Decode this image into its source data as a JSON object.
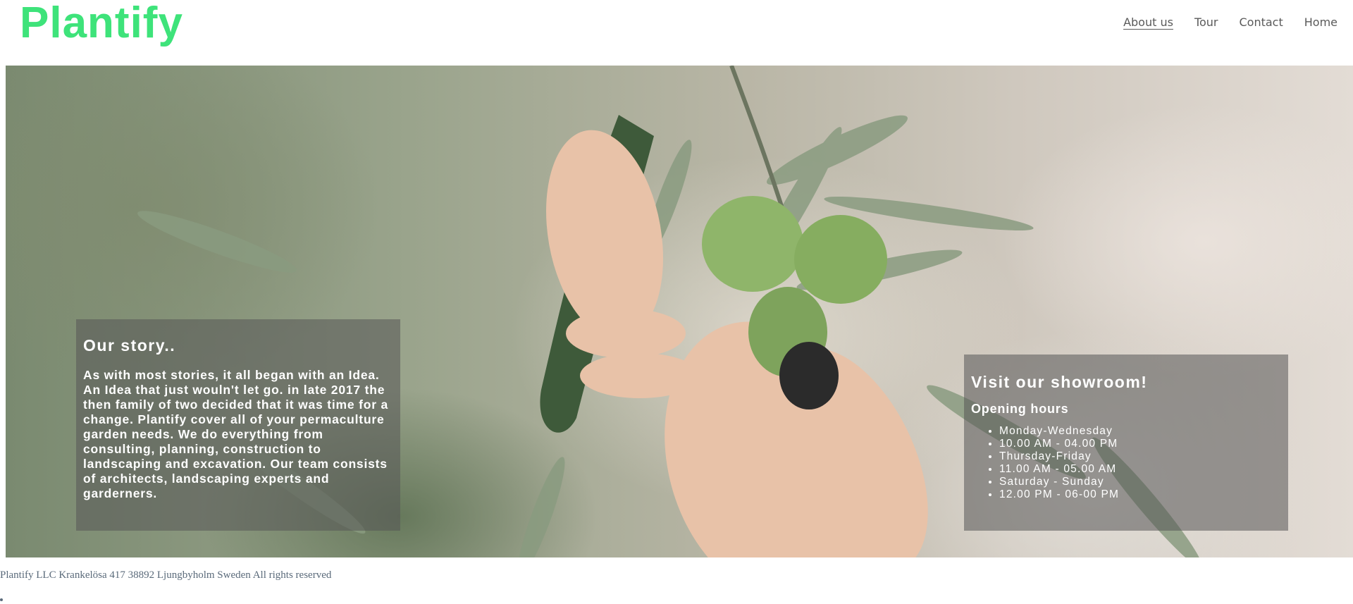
{
  "header": {
    "logo": "Plantify",
    "nav": [
      {
        "label": "About us",
        "active": true
      },
      {
        "label": "Tour",
        "active": false
      },
      {
        "label": "Contact",
        "active": false
      },
      {
        "label": "Home",
        "active": false
      }
    ]
  },
  "story": {
    "title": "Our story..",
    "body": "As with most stories, it all began with an Idea. An Idea that just wouln't let go. in late 2017 the then family of two decided that it was time for a change. Plantify cover all of your permaculture garden needs. We do everything from consulting, planning, construction to landscaping and excavation. Our team consists of architects, landscaping experts and garderners."
  },
  "showroom": {
    "title": "Visit our showroom!",
    "subtitle": "Opening hours",
    "hours": [
      "Monday-Wednesday",
      "10.00 AM - 04.00 PM",
      "Thursday-Friday",
      "11.00 AM - 05.00 AM",
      "Saturday - Sunday",
      "12.00 PM - 06-00 PM"
    ]
  },
  "footer": {
    "text": "Plantify LLC Krankelösa 417 38892 Ljungbyholm Sweden All rights reserved"
  },
  "colors": {
    "brand": "#3ee37a",
    "nav_text": "#5a5a5a",
    "card_bg": "rgba(85,85,85,0.55)"
  }
}
